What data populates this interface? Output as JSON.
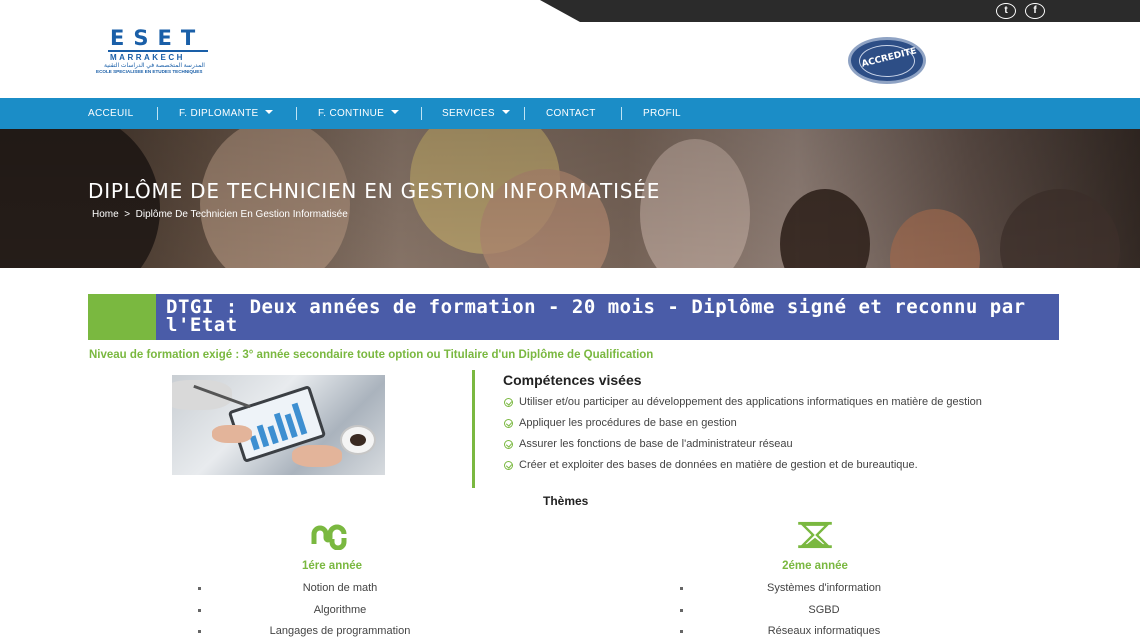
{
  "header": {
    "logo": {
      "name": "ESET",
      "city": "MARRAKECH",
      "arabic": "المدرسة المتخصصة في الدراسات التقنية",
      "subtitle": "ECOLE SPECIALISEE EN ETUDES TECHNIQUES"
    },
    "badge_text": "ACCREDITE",
    "social": [
      {
        "name": "twitter",
        "glyph": "t"
      },
      {
        "name": "facebook",
        "glyph": "f"
      }
    ]
  },
  "nav": {
    "items": [
      {
        "label": "ACCEUIL",
        "dropdown": false
      },
      {
        "label": "F. DIPLOMANTE",
        "dropdown": true
      },
      {
        "label": "F. CONTINUE",
        "dropdown": true
      },
      {
        "label": "SERVICES",
        "dropdown": true
      },
      {
        "label": "CONTACT",
        "dropdown": false
      },
      {
        "label": "PROFIL",
        "dropdown": false
      }
    ]
  },
  "hero": {
    "title": "DIPLÔME DE TECHNICIEN EN GESTION INFORMATISÉE",
    "breadcrumb": {
      "home": "Home",
      "separator": ">",
      "current": "Diplôme De Technicien En Gestion Informatisée"
    }
  },
  "main": {
    "title": "DTGI : Deux années de formation - 20 mois - Diplôme signé et reconnu par l'Etat",
    "niveau": "Niveau de formation exigé : 3° année secondaire toute option ou Titulaire d'un Diplôme de Qualification",
    "competences": {
      "title": "Compétences visées",
      "items": [
        "Utiliser et/ou participer au développement des applications informatiques en matière de gestion",
        "Appliquer les procédures de base en gestion",
        "Assurer les fonctions de base de l'administrateur réseau",
        "Créer et exploiter des bases de données en matière de gestion et de bureautique."
      ]
    },
    "themes_label": "Thèmes",
    "years": [
      {
        "title": "1ére année",
        "icon": "stumbleupon-icon",
        "items": [
          "Notion de math",
          "Algorithme",
          "Langages de programmation"
        ]
      },
      {
        "title": "2éme année",
        "icon": "hourglass-icon",
        "items": [
          "Systèmes d'information",
          "SGBD",
          "Réseaux informatiques"
        ]
      }
    ]
  },
  "colors": {
    "nav": "#1b8dc7",
    "green": "#7ab840",
    "title_blue": "#4a5ca8",
    "topbar": "#2b2b2b"
  }
}
